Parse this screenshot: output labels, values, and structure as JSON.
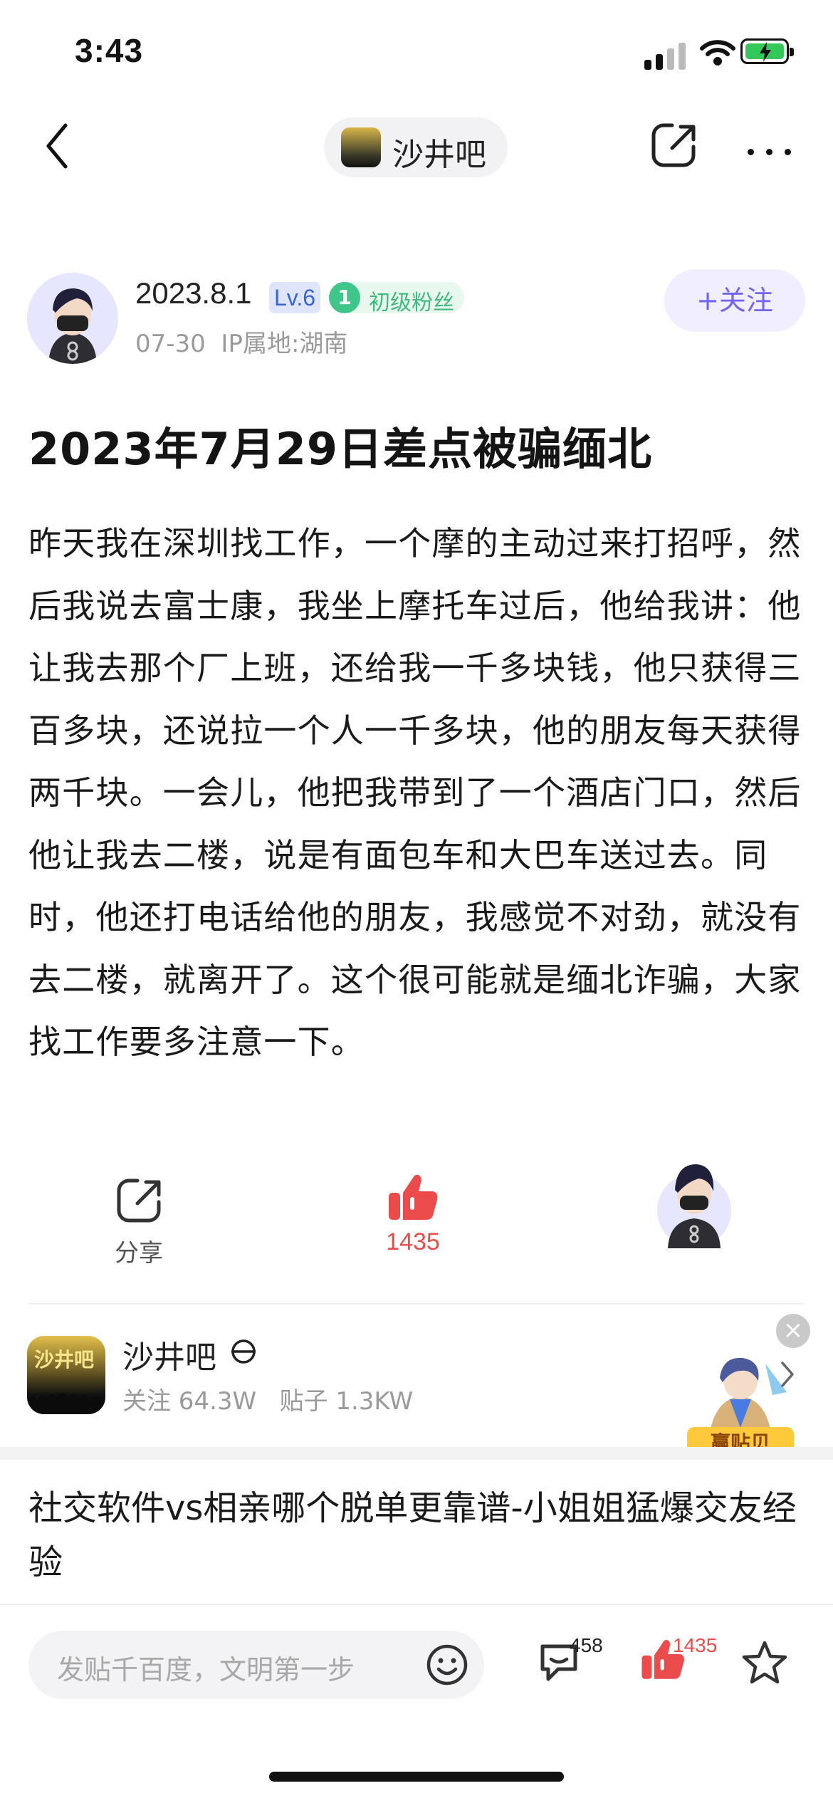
{
  "status": {
    "time": "3:43"
  },
  "nav": {
    "forum_name": "沙井吧"
  },
  "author": {
    "name": "2023.8.1",
    "level": "Lv.6",
    "fan_level_num": "1",
    "fan_label": "初级粉丝",
    "meta": "07-30  IP属地:湖南",
    "follow_label": "+关注"
  },
  "post": {
    "title": "2023年7月29日差点被骗缅北",
    "body": "昨天我在深圳找工作，一个摩的主动过来打招呼，然后我说去富士康，我坐上摩托车过后，他给我讲：他让我去那个厂上班，还给我一千多块钱，他只获得三百多块，还说拉一个人一千多块，他的朋友每天获得两千块。一会儿，他把我带到了一个酒店门口，然后他让我去二楼，说是有面包车和大巴车送过去。同时，他还打电话给他的朋友，我感觉不对劲，就没有去二楼，就离开了。这个很可能就是缅北诈骗，大家找工作要多注意一下。"
  },
  "actions": {
    "share_label": "分享",
    "like_count": "1435"
  },
  "forum_card": {
    "icon_text": "沙井吧",
    "name": "沙井吧",
    "stats": "关注 64.3W   贴子 1.3KW",
    "mascot_tag": "赢贴贝"
  },
  "related": {
    "title": "社交软件vs相亲哪个脱单更靠谱-小姐姐猛爆交友经验"
  },
  "bottom": {
    "placeholder": "发贴千百度，文明第一步",
    "comment_count": "458",
    "like_count": "1435"
  },
  "colors": {
    "accent": "#7364f2",
    "like": "#ec4b4b",
    "fan": "#3fba7f"
  }
}
